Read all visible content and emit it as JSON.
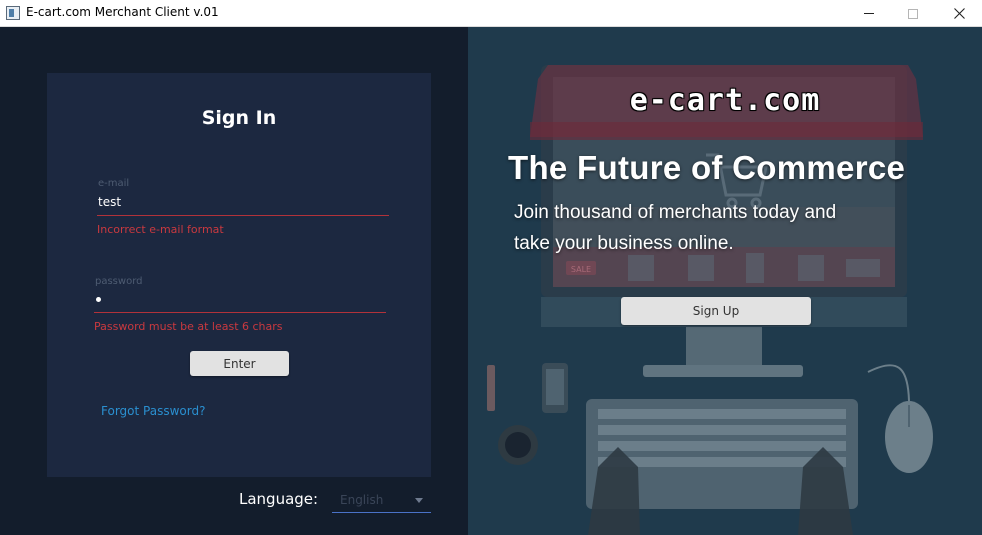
{
  "window": {
    "title": "E-cart.com Merchant Client v.01"
  },
  "signin": {
    "title": "Sign In",
    "email": {
      "label": "e-mail",
      "value": "test",
      "error": "Incorrect e-mail format"
    },
    "password": {
      "label": "password",
      "error": "Password must be at least 6 chars"
    },
    "enter_label": "Enter",
    "forgot_label": "Forgot Password?"
  },
  "language": {
    "label": "Language:",
    "selected": "English"
  },
  "promo": {
    "logo": "e-cart.com",
    "headline": "The Future of Commerce",
    "line1": "Join thousand of merchants today and",
    "line2": "take your business online.",
    "signup_label": "Sign Up",
    "sale_tag": "SALE"
  },
  "colors": {
    "left_bg": "#131d2c",
    "card_bg": "#1c2840",
    "right_bg": "#1f3a4c",
    "error": "#c9393f",
    "link": "#2a8fcf"
  }
}
